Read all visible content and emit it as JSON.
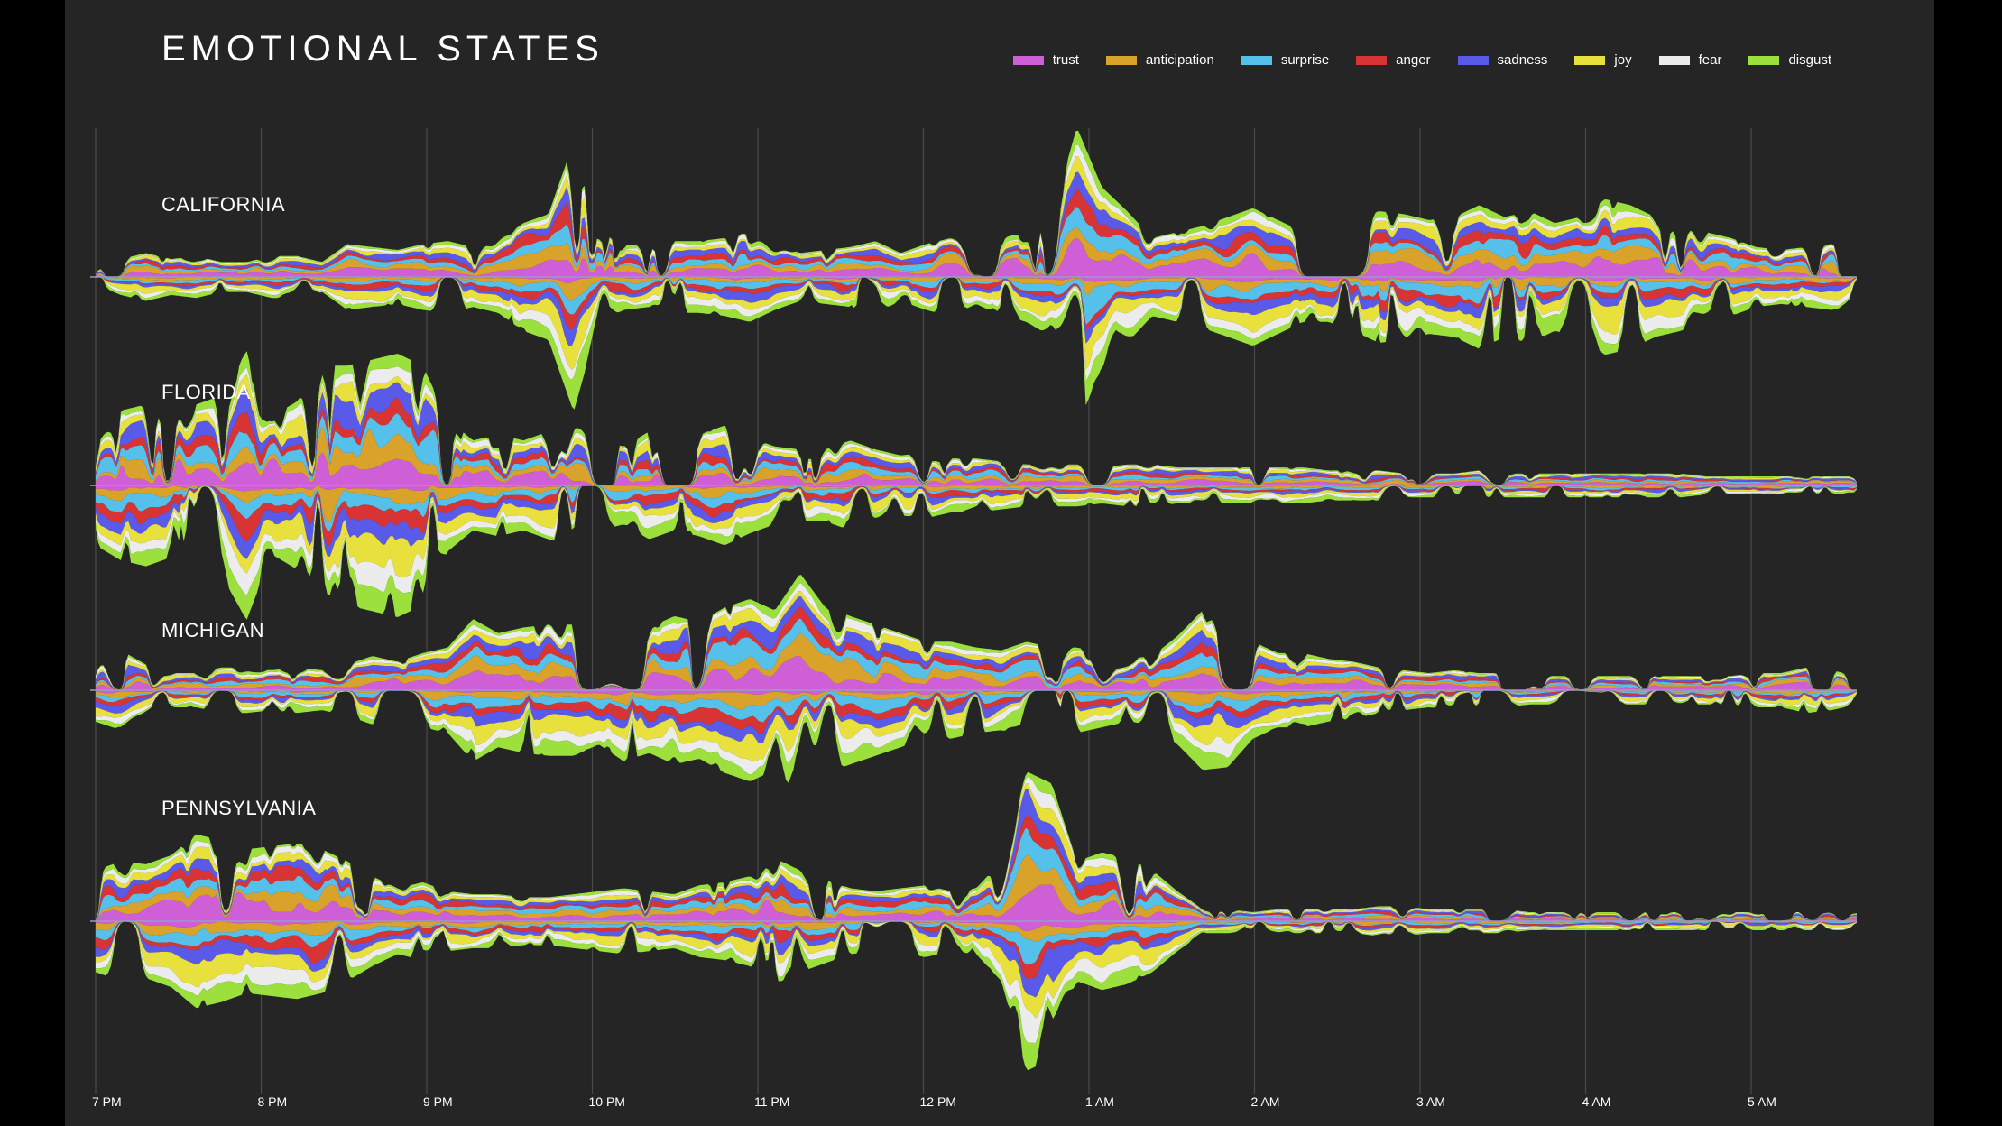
{
  "chart_data": {
    "type": "area",
    "subtype": "streamgraph",
    "title": "EMOTIONAL STATES",
    "xlabel": "",
    "ylabel": "",
    "grid": true,
    "legend_position": "top-right",
    "x_ticks": [
      "7 PM",
      "8 PM",
      "9 PM",
      "10 PM",
      "11 PM",
      "12 PM",
      "1 AM",
      "2 AM",
      "3 AM",
      "4 AM",
      "5 AM"
    ],
    "emotions": [
      {
        "name": "trust",
        "color": "#cf5fd6"
      },
      {
        "name": "anticipation",
        "color": "#d9a22b"
      },
      {
        "name": "surprise",
        "color": "#55c0ea"
      },
      {
        "name": "anger",
        "color": "#d93434"
      },
      {
        "name": "sadness",
        "color": "#5a5ae8"
      },
      {
        "name": "joy",
        "color": "#e8e03c"
      },
      {
        "name": "fear",
        "color": "#ececec"
      },
      {
        "name": "disgust",
        "color": "#9be03c"
      }
    ],
    "series": [
      {
        "name": "CALIFORNIA",
        "intensity": [
          0.05,
          0.12,
          0.16,
          0.12,
          0.14,
          0.1,
          0.1,
          0.14,
          0.14,
          0.1,
          0.22,
          0.2,
          0.18,
          0.22,
          0.24,
          0.2,
          0.24,
          0.36,
          0.42,
          0.9,
          0.3,
          0.22,
          0.2,
          0.24,
          0.24,
          0.26,
          0.3,
          0.22,
          0.16,
          0.18,
          0.2,
          0.24,
          0.16,
          0.22,
          0.26,
          0.18,
          0.26,
          0.3,
          0.4,
          1.0,
          0.6,
          0.44,
          0.26,
          0.3,
          0.34,
          0.4,
          0.46,
          0.38,
          0.3,
          0.3,
          0.36,
          0.44,
          0.42,
          0.38,
          0.4,
          0.48,
          0.4,
          0.44,
          0.36,
          0.4,
          0.52,
          0.48,
          0.4,
          0.36,
          0.3,
          0.26,
          0.2,
          0.18,
          0.2,
          0.22,
          0.18
        ]
      },
      {
        "name": "FLORIDA",
        "intensity": [
          0.4,
          0.5,
          0.54,
          0.48,
          0.54,
          0.6,
          0.9,
          0.46,
          0.56,
          0.8,
          0.8,
          0.84,
          0.88,
          0.8,
          0.44,
          0.3,
          0.34,
          0.3,
          0.36,
          0.4,
          0.3,
          0.26,
          0.36,
          0.3,
          0.34,
          0.4,
          0.32,
          0.26,
          0.24,
          0.24,
          0.3,
          0.24,
          0.2,
          0.22,
          0.18,
          0.18,
          0.16,
          0.14,
          0.14,
          0.14,
          0.12,
          0.14,
          0.14,
          0.12,
          0.12,
          0.12,
          0.12,
          0.12,
          0.12,
          0.1,
          0.1,
          0.1,
          0.08,
          0.08,
          0.08,
          0.1,
          0.08,
          0.08,
          0.08,
          0.08,
          0.08,
          0.08,
          0.08,
          0.08,
          0.06,
          0.06,
          0.06,
          0.06,
          0.06,
          0.06,
          0.06
        ]
      },
      {
        "name": "MICHIGAN",
        "intensity": [
          0.22,
          0.28,
          0.18,
          0.12,
          0.12,
          0.16,
          0.16,
          0.14,
          0.16,
          0.14,
          0.18,
          0.24,
          0.2,
          0.26,
          0.3,
          0.5,
          0.4,
          0.44,
          0.46,
          0.46,
          0.38,
          0.5,
          0.44,
          0.52,
          0.48,
          0.58,
          0.64,
          0.56,
          0.82,
          0.58,
          0.52,
          0.46,
          0.4,
          0.34,
          0.34,
          0.3,
          0.28,
          0.34,
          0.3,
          0.3,
          0.26,
          0.22,
          0.24,
          0.38,
          0.56,
          0.54,
          0.34,
          0.26,
          0.26,
          0.22,
          0.2,
          0.16,
          0.14,
          0.12,
          0.14,
          0.12,
          0.12,
          0.1,
          0.1,
          0.1,
          0.1,
          0.1,
          0.1,
          0.1,
          0.1,
          0.1,
          0.12,
          0.12,
          0.16,
          0.14,
          0.1
        ]
      },
      {
        "name": "PENNSYLVANIA",
        "intensity": [
          0.34,
          0.4,
          0.38,
          0.44,
          0.58,
          0.54,
          0.48,
          0.5,
          0.52,
          0.48,
          0.4,
          0.3,
          0.22,
          0.26,
          0.2,
          0.18,
          0.18,
          0.16,
          0.16,
          0.18,
          0.2,
          0.22,
          0.2,
          0.18,
          0.24,
          0.26,
          0.3,
          0.42,
          0.34,
          0.28,
          0.22,
          0.2,
          0.22,
          0.24,
          0.2,
          0.22,
          0.4,
          1.0,
          0.92,
          0.4,
          0.46,
          0.42,
          0.34,
          0.2,
          0.08,
          0.08,
          0.06,
          0.08,
          0.08,
          0.08,
          0.08,
          0.1,
          0.1,
          0.08,
          0.08,
          0.08,
          0.08,
          0.06,
          0.06,
          0.06,
          0.06,
          0.06,
          0.06,
          0.06,
          0.06,
          0.06,
          0.06,
          0.06,
          0.06,
          0.06,
          0.06
        ]
      }
    ]
  }
}
